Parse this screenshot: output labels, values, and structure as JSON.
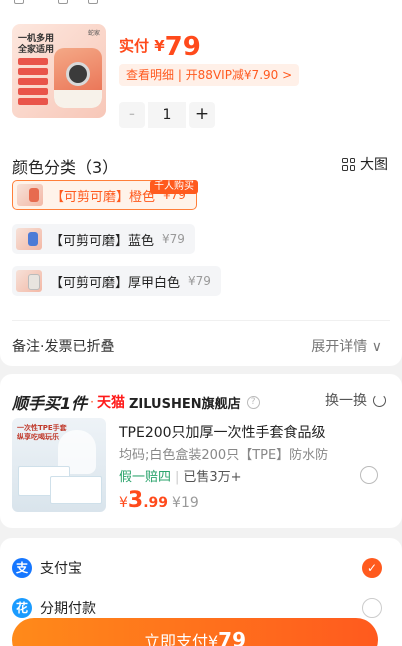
{
  "product": {
    "thumb_tag": "一机多用\n全家适用",
    "brand": "蛇家",
    "price_label": "实付 ¥",
    "price_value": "79",
    "detail_pill": "查看明细 | 开88VIP减¥7.90 >",
    "stepper": {
      "minus": "-",
      "qty": "1",
      "plus": "+"
    }
  },
  "color_section": {
    "title": "颜色分类（3）",
    "big_view": "大图",
    "badge": "千人购买",
    "options": [
      {
        "name": "【可剪可磨】橙色",
        "price": "¥79",
        "selected": true
      },
      {
        "name": "【可剪可磨】蓝色",
        "price": "¥79",
        "selected": false
      },
      {
        "name": "【可剪可磨】厚甲白色",
        "price": "¥79",
        "selected": false
      }
    ]
  },
  "remark": {
    "label": "备注·发票已折叠",
    "expand": "展开详情 ∨"
  },
  "addon": {
    "head_title": "顺手买1件",
    "dot": "·",
    "tmall": "天猫",
    "store": "ZILUSHEN旗舰店",
    "help": "?",
    "swap": "换一换",
    "image_text": "一次性TPE手套\n纵享吃喝玩乐",
    "title": "TPE200只加厚一次性手套食品级",
    "spec": "均码;白色盒装200只【TPE】防水防",
    "guarantee": "假一赔四",
    "sep": "|",
    "sold": "已售3万+",
    "price_currency": "¥",
    "price_int": "3",
    "price_dec": ".99",
    "price_orig": "¥19"
  },
  "payment": {
    "methods": [
      {
        "icon": "支",
        "label": "支付宝",
        "checked": true,
        "check_mark": "✓"
      },
      {
        "icon": "花",
        "label": "分期付款",
        "checked": false
      }
    ],
    "submit_label": "立即支付¥",
    "submit_amount": "79"
  }
}
